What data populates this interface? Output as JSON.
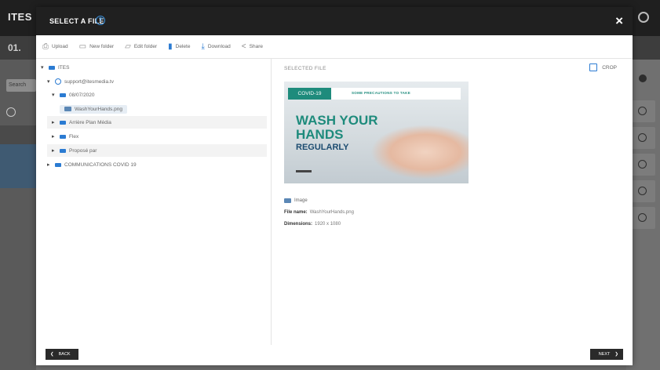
{
  "app": {
    "logo": "ITES",
    "step": "01.",
    "search_placeholder": "Search"
  },
  "modal": {
    "title": "SELECT A FILE",
    "help_icon": "?",
    "close_icon": "×",
    "toolbar": [
      {
        "icon": "upload-icon",
        "label": "Upload"
      },
      {
        "icon": "new-folder-icon",
        "label": "New folder"
      },
      {
        "icon": "edit-folder-icon",
        "label": "Edit folder"
      },
      {
        "icon": "delete-icon",
        "label": "Delete"
      },
      {
        "icon": "download-icon",
        "label": "Download"
      },
      {
        "icon": "share-icon",
        "label": "Share"
      }
    ],
    "tree": [
      {
        "label": "ITES",
        "depth": 0,
        "arrow": "▾",
        "kind": "root"
      },
      {
        "label": "support@itesmedia.tv",
        "depth": 1,
        "arrow": "▾",
        "kind": "globe"
      },
      {
        "label": "08/07/2020",
        "depth": 2,
        "arrow": "▾",
        "kind": "folder"
      },
      {
        "label": "WashYourHands.png",
        "depth": 3,
        "arrow": "",
        "kind": "file"
      },
      {
        "label": "Arrière Plan Média",
        "depth": 2,
        "arrow": "▸",
        "kind": "folder"
      },
      {
        "label": "Flex",
        "depth": 2,
        "arrow": "▸",
        "kind": "folder"
      },
      {
        "label": "Proposé par",
        "depth": 2,
        "arrow": "▸",
        "kind": "folder"
      },
      {
        "label": "COMMUNICATIONS COVID 19",
        "depth": 1,
        "arrow": "▸",
        "kind": "folder"
      }
    ],
    "preview": {
      "selected_label": "SELECTED FILE",
      "crop_label": "CROP",
      "thumbnail": {
        "badge": "COVID-19",
        "subtitle": "SOME PRECAUTIONS TO TAKE",
        "headline_1": "WASH YOUR",
        "headline_2": "HANDS",
        "headline_3": "REGULARLY"
      },
      "type": "Image",
      "file_name_label": "File name:",
      "file_name": "WashYourHands.png",
      "dimensions_label": "Dimensions:",
      "dimensions": "1920 x 1080"
    },
    "footer": {
      "back_label": "BACK",
      "back_icon": "❮",
      "next_label": "NEXT",
      "next_icon": "❯"
    }
  },
  "colors": {
    "accent": "#2b7bd2",
    "header": "#202020",
    "teal": "#1e8b7c",
    "navy": "#1c4c70"
  }
}
